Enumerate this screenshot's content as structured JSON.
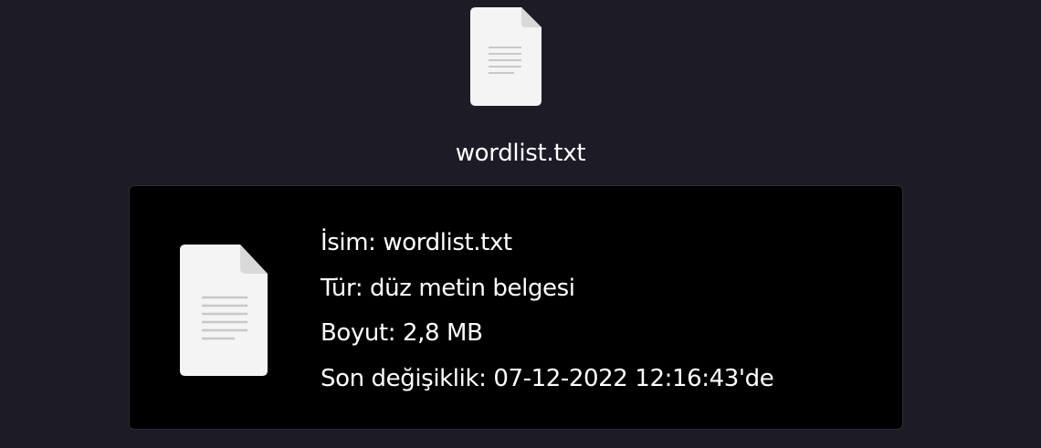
{
  "desktop_file": {
    "icon": "text-file-icon",
    "name": "wordlist.txt"
  },
  "tooltip": {
    "icon": "text-file-icon",
    "lines": [
      "İsim: wordlist.txt",
      "Tür: düz metin belgesi",
      "Boyut: 2,8 MB",
      "Son değişiklik: 07-12-2022 12:16:43'de"
    ]
  },
  "colors": {
    "background": "#1c1b26",
    "tooltip_background": "#000000",
    "icon_fill": "#f4f4f4",
    "icon_lines": "#c8c8c8",
    "text": "#ffffff"
  }
}
